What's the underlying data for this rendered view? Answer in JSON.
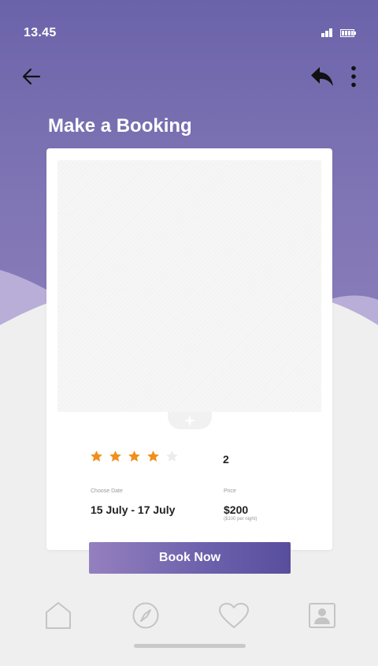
{
  "status_bar": {
    "time": "13.45",
    "icons": [
      "signal-icon",
      "battery-icon"
    ]
  },
  "toolbar": {
    "back_icon": "arrow-left-icon",
    "share_icon": "reply-arrow-icon",
    "more_icon": "vertical-ellipsis-icon"
  },
  "page": {
    "title": "Make a Booking"
  },
  "booking": {
    "rating": 4,
    "rating_max": 5,
    "guests": "2",
    "date_label": "Choose Date",
    "date_value": "15 July - 17 July",
    "price_label": "Price",
    "price_value": "$200",
    "price_note": "($100 per night)",
    "book_label": "Book Now"
  },
  "bottom_nav": {
    "items": [
      {
        "name": "home",
        "icon": "home-icon"
      },
      {
        "name": "explore",
        "icon": "compass-icon"
      },
      {
        "name": "favorites",
        "icon": "heart-icon"
      },
      {
        "name": "profile",
        "icon": "user-profile-icon"
      }
    ]
  },
  "colors": {
    "header_top": "#6b63aa",
    "header_bottom": "#8a7cba",
    "wave_light": "#b8aed8",
    "star_filled": "#f0901c",
    "star_empty": "#ececec",
    "button_start": "#9580bf",
    "button_end": "#574e9d",
    "nav_icon": "#c4c4c4"
  }
}
